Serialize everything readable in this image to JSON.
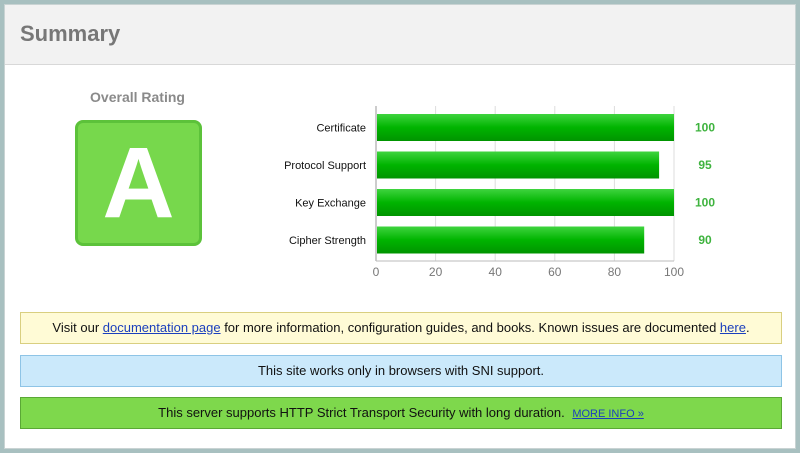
{
  "header": {
    "title": "Summary"
  },
  "rating": {
    "label": "Overall Rating",
    "grade": "A"
  },
  "chart_data": {
    "type": "bar",
    "orientation": "horizontal",
    "categories": [
      "Certificate",
      "Protocol Support",
      "Key Exchange",
      "Cipher Strength"
    ],
    "values": [
      100,
      95,
      100,
      90
    ],
    "xlim": [
      0,
      100
    ],
    "xticks": [
      "0",
      "20",
      "40",
      "60",
      "80",
      "100"
    ],
    "bar_color": "#00b400",
    "value_label_color": "#3eb33e",
    "grid": true
  },
  "notices": {
    "docs": {
      "prefix": "Visit our ",
      "link1": "documentation page",
      "middle": " for more information, configuration guides, and books. Known issues are documented ",
      "link2": "here",
      "suffix": "."
    },
    "sni": {
      "text": "This site works only in browsers with SNI support."
    },
    "hsts": {
      "text": "This server supports HTTP Strict Transport Security with long duration.",
      "link": "MORE INFO »"
    }
  },
  "colors": {
    "grade_green": "#77d84c",
    "docs_bg": "#fffbd6",
    "sni_bg": "#cbe9fb",
    "hsts_bg": "#7ed84c"
  }
}
